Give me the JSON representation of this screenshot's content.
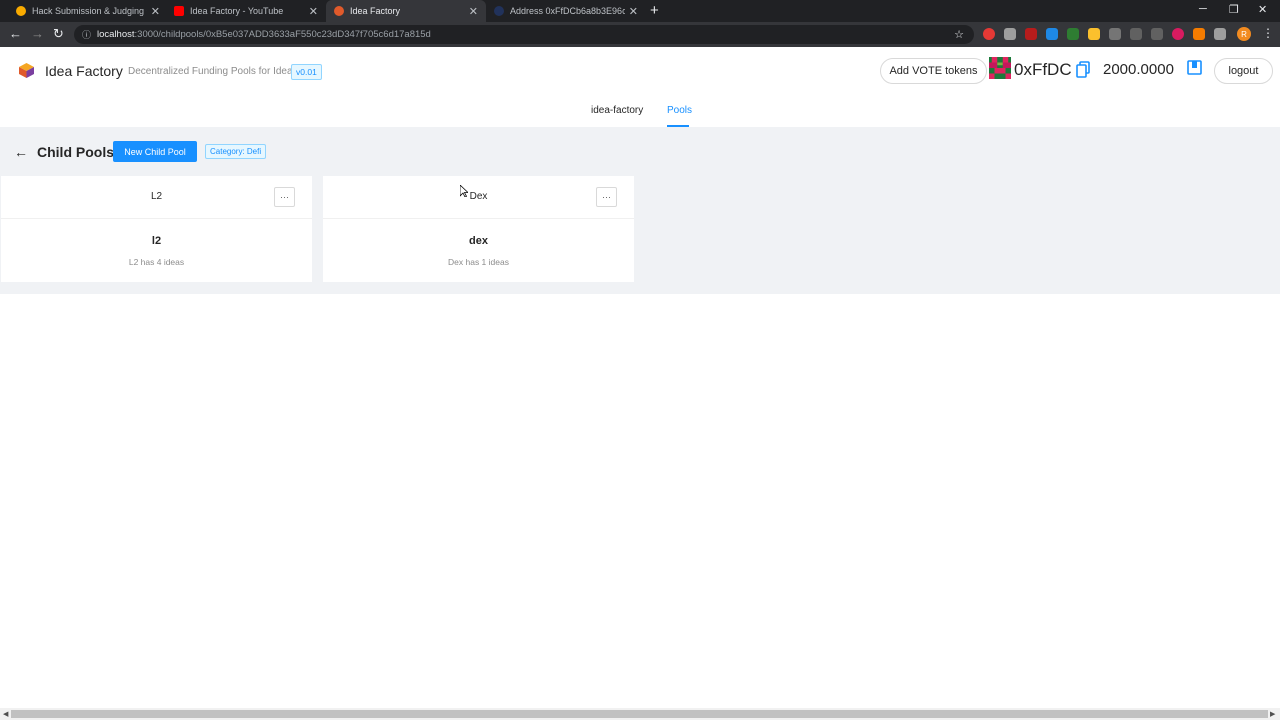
{
  "browser": {
    "tabs": [
      {
        "title": "Hack Submission & Judging Gui",
        "favicon_color": "#f9ab00",
        "active": false
      },
      {
        "title": "Idea Factory - YouTube",
        "favicon_color": "#ff0000",
        "active": false
      },
      {
        "title": "Idea Factory",
        "favicon_color": "#e05a2b",
        "active": true
      },
      {
        "title": "Address 0xFfDCb6a8b3E96c97aD",
        "favicon_color": "#21325b",
        "active": false
      }
    ],
    "url_host": "localhost",
    "url_path": ":3000/childpools/0xB5e037ADD3633aF550c23dD347f705c6d17a815d",
    "profile_initial": "R"
  },
  "app": {
    "name": "Idea Factory",
    "tagline": "Decentralized Funding Pools for Ideas",
    "version": "v0.01",
    "add_tokens_label": "Add VOTE tokens",
    "address": "0xFfDC",
    "balance": "2000.0000",
    "logout_label": "logout",
    "nav": [
      {
        "label": "idea-factory",
        "active": false
      },
      {
        "label": "Pools",
        "active": true
      }
    ]
  },
  "page": {
    "title": "Child Pools",
    "new_button": "New Child Pool",
    "category_tag": "Category: Defi",
    "cards": [
      {
        "title": "L2",
        "more": "···",
        "name": "l2",
        "description": "L2 has 4 ideas"
      },
      {
        "title": "Dex",
        "more": "···",
        "name": "dex",
        "description": "Dex has 1 ideas"
      }
    ]
  },
  "colors": {
    "accent": "#1890ff",
    "page_bg": "#f0f2f5",
    "chrome_dark": "#202124"
  }
}
